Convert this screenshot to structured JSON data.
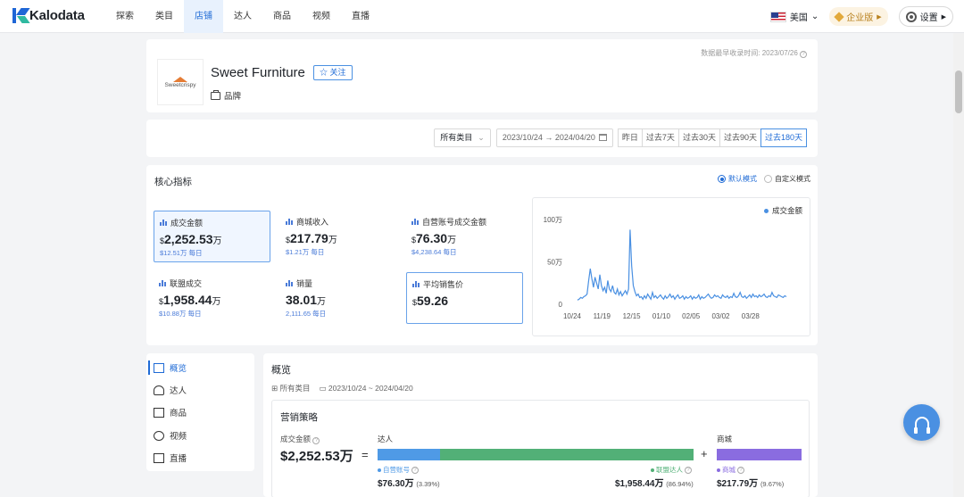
{
  "brand": {
    "name": "Kalodata"
  },
  "nav": {
    "tabs": [
      {
        "label": "探索"
      },
      {
        "label": "类目"
      },
      {
        "label": "店铺"
      },
      {
        "label": "达人"
      },
      {
        "label": "商品"
      },
      {
        "label": "视频"
      },
      {
        "label": "直播"
      }
    ],
    "active_tab": "店铺",
    "country": "美国",
    "enterprise": "企业版",
    "settings": "设置"
  },
  "shop": {
    "updated": "数据最早收录时间: 2023/07/26",
    "logo_text": "Sweetcrispy",
    "name": "Sweet Furniture",
    "follow": "☆ 关注",
    "tag": "品牌"
  },
  "filters": {
    "category": "所有类目",
    "date_range": "2023/10/24 → 2024/04/20",
    "periods": [
      "昨日",
      "过去7天",
      "过去30天",
      "过去90天",
      "过去180天"
    ],
    "active_period": "过去180天"
  },
  "metrics": {
    "title": "核心指标",
    "modes": [
      "默认模式",
      "自定义模式"
    ],
    "items": [
      {
        "label": "成交金额",
        "currency": "$",
        "value": "2,252.53",
        "unit": "万",
        "sub": "$12.51万 每日"
      },
      {
        "label": "商城收入",
        "currency": "$",
        "value": "217.79",
        "unit": "万",
        "sub": "$1.21万 每日"
      },
      {
        "label": "自营账号成交金额",
        "currency": "$",
        "value": "76.30",
        "unit": "万",
        "sub": "$4,238.64 每日"
      },
      {
        "label": "联盟成交",
        "currency": "$",
        "value": "1,958.44",
        "unit": "万",
        "sub": "$10.88万 每日"
      },
      {
        "label": "销量",
        "currency": "",
        "value": "38.01",
        "unit": "万",
        "sub": "2,111.65 每日"
      },
      {
        "label": "平均销售价",
        "currency": "$",
        "value": "59.26",
        "unit": "",
        "sub": ""
      }
    ]
  },
  "chart_data": {
    "type": "line",
    "series": [
      {
        "name": "成交金额",
        "color": "#4a90e2"
      }
    ],
    "x_ticks": [
      "10/24",
      "11/19",
      "12/15",
      "01/10",
      "02/05",
      "03/02",
      "03/28"
    ],
    "y_ticks": [
      "0",
      "50万",
      "100万"
    ],
    "ylim": [
      0,
      100
    ],
    "values": [
      5,
      6,
      8,
      7,
      9,
      10,
      12,
      28,
      42,
      30,
      20,
      32,
      25,
      18,
      35,
      22,
      16,
      20,
      13,
      28,
      18,
      15,
      22,
      14,
      12,
      18,
      11,
      15,
      10,
      13,
      16,
      12,
      18,
      88,
      45,
      22,
      15,
      10,
      12,
      8,
      9,
      6,
      10,
      7,
      12,
      9,
      6,
      14,
      8,
      10,
      7,
      9,
      11,
      8,
      6,
      10,
      7,
      9,
      12,
      8,
      10,
      6,
      9,
      11,
      7,
      8,
      10,
      6,
      9,
      7,
      8,
      10,
      6,
      9,
      7,
      8,
      11,
      6,
      9,
      7,
      8,
      10,
      12,
      9,
      7,
      8,
      11,
      9,
      10,
      8,
      7,
      11,
      9,
      8,
      10,
      7,
      9,
      8,
      13,
      9,
      8,
      10,
      14,
      9,
      8,
      10,
      7,
      9,
      11,
      8,
      12,
      9,
      10,
      8,
      11,
      9,
      10,
      12,
      9,
      8,
      10,
      9,
      14,
      10,
      9,
      8,
      11,
      10,
      9,
      8,
      10,
      9
    ]
  },
  "sidebar": {
    "items": [
      {
        "label": "概览"
      },
      {
        "label": "达人"
      },
      {
        "label": "商品"
      },
      {
        "label": "视频"
      },
      {
        "label": "直播"
      }
    ]
  },
  "overview": {
    "title": "概览",
    "category": "所有类目",
    "date_range": "2023/10/24 ~ 2024/04/20",
    "strategy": {
      "title": "营销策略",
      "gmv_label": "成交金额",
      "gmv_value": "$2,252.53万",
      "creator_label": "达人",
      "mall_label": "商城",
      "self_label": "自营账号",
      "affiliate_label": "联盟达人",
      "mall_sub_label": "商城",
      "self_amount": "$76.30万",
      "self_pct": "(3.39%)",
      "affiliate_amount": "$1,958.44万",
      "affiliate_pct": "(86.94%)",
      "mall_amount": "$217.79万",
      "mall_pct": "(9.67%)",
      "colors": {
        "self": "#4f9ae6",
        "affiliate": "#52b077",
        "mall": "#8a6ce0"
      }
    }
  }
}
